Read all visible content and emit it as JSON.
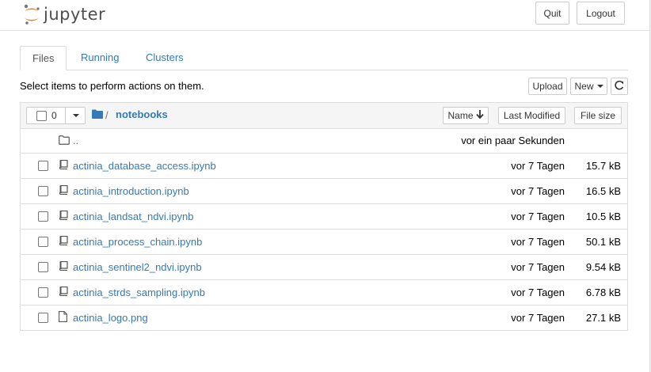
{
  "header": {
    "logo_text": "jupyter",
    "quit_label": "Quit",
    "logout_label": "Logout"
  },
  "tabs": [
    {
      "label": "Files",
      "active": true
    },
    {
      "label": "Running",
      "active": false
    },
    {
      "label": "Clusters",
      "active": false
    }
  ],
  "toolbar": {
    "hint": "Select items to perform actions on them.",
    "upload_label": "Upload",
    "new_label": "New",
    "refresh_icon": "refresh-icon"
  },
  "list_header": {
    "selected_count": "0",
    "breadcrumb_separator": "/",
    "breadcrumb_folder": "notebooks",
    "sort_name_label": "Name",
    "sort_modified_label": "Last Modified",
    "sort_size_label": "File size"
  },
  "parent_row": {
    "name": "..",
    "modified": "vor ein paar Sekunden"
  },
  "files": [
    {
      "name": "actinia_database_access.ipynb",
      "modified": "vor 7 Tagen",
      "size": "15.7 kB",
      "icon": "notebook-icon"
    },
    {
      "name": "actinia_introduction.ipynb",
      "modified": "vor 7 Tagen",
      "size": "16.5 kB",
      "icon": "notebook-icon"
    },
    {
      "name": "actinia_landsat_ndvi.ipynb",
      "modified": "vor 7 Tagen",
      "size": "10.5 kB",
      "icon": "notebook-icon"
    },
    {
      "name": "actinia_process_chain.ipynb",
      "modified": "vor 7 Tagen",
      "size": "50.1 kB",
      "icon": "notebook-icon"
    },
    {
      "name": "actinia_sentinel2_ndvi.ipynb",
      "modified": "vor 7 Tagen",
      "size": "9.54 kB",
      "icon": "notebook-icon"
    },
    {
      "name": "actinia_strds_sampling.ipynb",
      "modified": "vor 7 Tagen",
      "size": "6.78 kB",
      "icon": "notebook-icon"
    },
    {
      "name": "actinia_logo.png",
      "modified": "vor 7 Tagen",
      "size": "27.1 kB",
      "icon": "file-icon"
    }
  ],
  "colors": {
    "link": "#337ab7",
    "logo_orange": "#f37726"
  }
}
